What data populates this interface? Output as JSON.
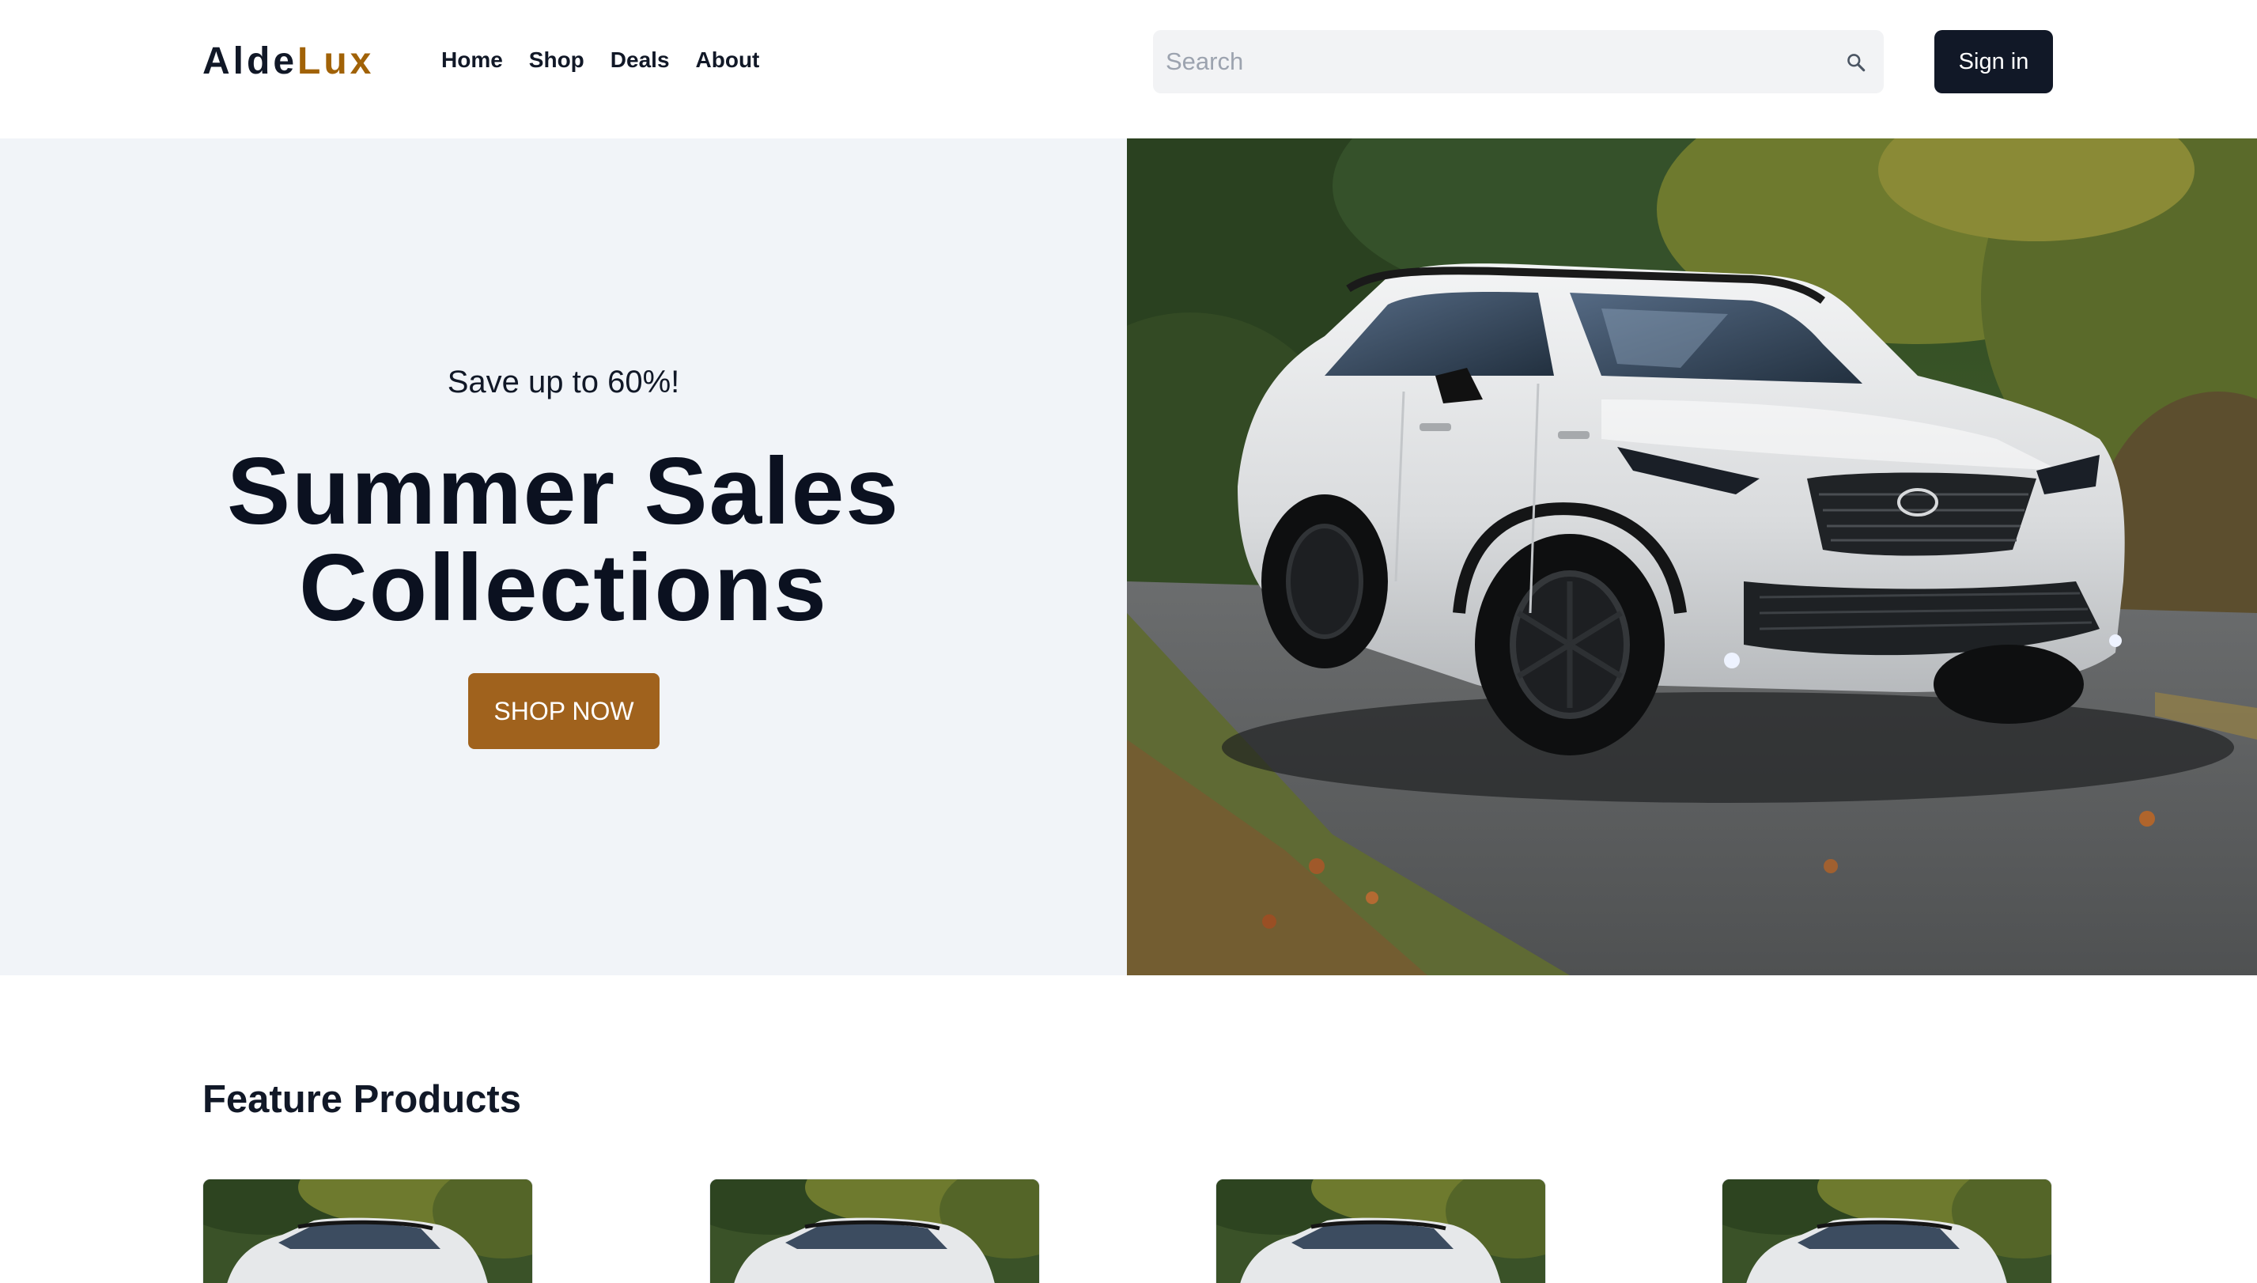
{
  "brand": {
    "part1": "Alde",
    "part2": "Lux"
  },
  "nav": {
    "items": [
      {
        "label": "Home"
      },
      {
        "label": "Shop"
      },
      {
        "label": "Deals"
      },
      {
        "label": "About"
      }
    ]
  },
  "search": {
    "placeholder": "Search",
    "value": "",
    "icon": "search-icon"
  },
  "signin": {
    "label": "Sign in"
  },
  "hero": {
    "tagline": "Save up to 60%!",
    "headline_line1": "Summer Sales",
    "headline_line2": "Collections",
    "cta_label": "SHOP NOW",
    "image": "white-suv-on-forest-road-photo"
  },
  "featured": {
    "title": "Feature Products",
    "products": [
      {
        "image": "white-suv-thumbnail"
      },
      {
        "image": "white-suv-thumbnail"
      },
      {
        "image": "white-suv-thumbnail"
      },
      {
        "image": "white-suv-thumbnail"
      }
    ]
  },
  "colors": {
    "brand_dark": "#111827",
    "brand_accent": "#a16207",
    "cta": "#a0621d",
    "hero_bg": "#f1f4f8",
    "search_bg": "#f2f3f5"
  }
}
